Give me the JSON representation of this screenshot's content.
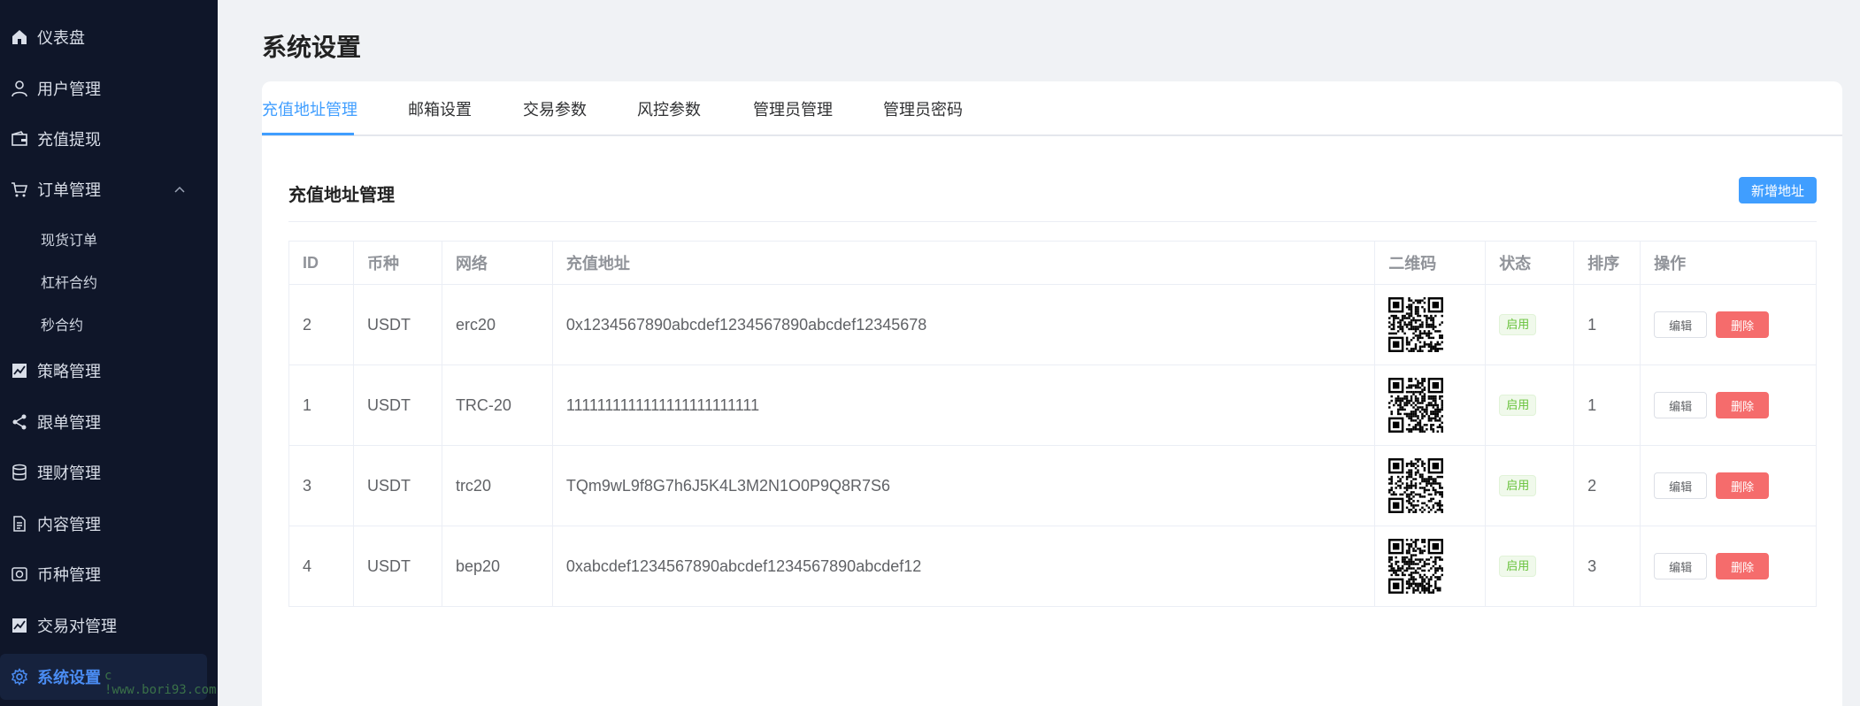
{
  "sidebar": {
    "items": [
      {
        "label": "仪表盘",
        "icon": "home-icon"
      },
      {
        "label": "用户管理",
        "icon": "user-icon"
      },
      {
        "label": "充值提现",
        "icon": "wallet-icon"
      },
      {
        "label": "订单管理",
        "icon": "cart-icon"
      },
      {
        "label": "策略管理",
        "icon": "chart-line-icon"
      },
      {
        "label": "跟单管理",
        "icon": "share-icon"
      },
      {
        "label": "理财管理",
        "icon": "database-icon"
      },
      {
        "label": "内容管理",
        "icon": "document-icon"
      },
      {
        "label": "币种管理",
        "icon": "coin-icon"
      },
      {
        "label": "交易对管理",
        "icon": "chart-line-icon"
      },
      {
        "label": "系统设置",
        "icon": "gear-icon"
      }
    ],
    "sub_items": [
      "现货订单",
      "杠杆合约",
      "秒合约"
    ],
    "watermark": "c  !www.bori93.com"
  },
  "page": {
    "title": "系统设置"
  },
  "tabs": [
    "充值地址管理",
    "邮箱设置",
    "交易参数",
    "风控参数",
    "管理员管理",
    "管理员密码"
  ],
  "section": {
    "title": "充值地址管理",
    "add_button": "新增地址"
  },
  "table": {
    "headers": [
      "ID",
      "币种",
      "网络",
      "充值地址",
      "二维码",
      "状态",
      "排序",
      "操作"
    ],
    "rows": [
      {
        "id": "2",
        "coin": "USDT",
        "network": "erc20",
        "address": "0x1234567890abcdef1234567890abcdef12345678",
        "status": "启用",
        "sort": "1"
      },
      {
        "id": "1",
        "coin": "USDT",
        "network": "TRC-20",
        "address": "1111111111111111111111111",
        "status": "启用",
        "sort": "1"
      },
      {
        "id": "3",
        "coin": "USDT",
        "network": "trc20",
        "address": "TQm9wL9f8G7h6J5K4L3M2N1O0P9Q8R7S6",
        "status": "启用",
        "sort": "2"
      },
      {
        "id": "4",
        "coin": "USDT",
        "network": "bep20",
        "address": "0xabcdef1234567890abcdef1234567890abcdef12",
        "status": "启用",
        "sort": "3"
      }
    ],
    "edit_label": "编辑",
    "delete_label": "删除"
  },
  "colors": {
    "sidebar_bg": "#0f1629",
    "accent": "#409eff",
    "danger": "#f56c6c",
    "success": "#67c23a"
  }
}
